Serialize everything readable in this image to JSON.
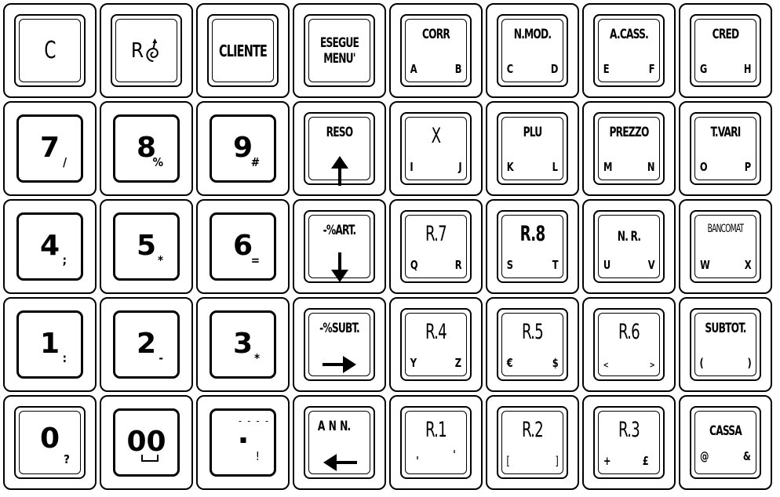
{
  "keyboard": {
    "rows": [
      [
        {
          "id": "c",
          "main": "C",
          "style": "double"
        },
        {
          "id": "r-spiral",
          "main": "R",
          "icon": "spiral-arrow-icon",
          "style": "double"
        },
        {
          "id": "cliente",
          "main": "CLIENTE",
          "style": "double"
        },
        {
          "id": "esegue-menu",
          "line1": "ESEGUE",
          "line2": "MENU'",
          "style": "double"
        },
        {
          "id": "corr",
          "top": "CORR",
          "left": "A",
          "right": "B",
          "style": "double"
        },
        {
          "id": "nmod",
          "top": "N.MOD.",
          "left": "C",
          "right": "D",
          "style": "double"
        },
        {
          "id": "acass",
          "top": "A.CASS.",
          "left": "E",
          "right": "F",
          "style": "double"
        },
        {
          "id": "cred",
          "top": "CRED",
          "left": "G",
          "right": "H",
          "style": "double"
        }
      ],
      [
        {
          "id": "7",
          "digit": "7",
          "sub": "/",
          "style": "single"
        },
        {
          "id": "8",
          "digit": "8",
          "sub": "%",
          "style": "single"
        },
        {
          "id": "9",
          "digit": "9",
          "sub": "#",
          "style": "single"
        },
        {
          "id": "reso",
          "top": "RESO",
          "icon": "arrow-up-icon",
          "style": "double"
        },
        {
          "id": "x",
          "main": "X",
          "left": "I",
          "right": "J",
          "style": "double"
        },
        {
          "id": "plu",
          "top": "PLU",
          "left": "K",
          "right": "L",
          "style": "double"
        },
        {
          "id": "prezzo",
          "top": "PREZZO",
          "left": "M",
          "right": "N",
          "style": "double"
        },
        {
          "id": "tvari",
          "top": "T.VARI",
          "left": "O",
          "right": "P",
          "style": "double"
        }
      ],
      [
        {
          "id": "4",
          "digit": "4",
          "sub": ";",
          "style": "single"
        },
        {
          "id": "5",
          "digit": "5",
          "sub": "*",
          "style": "single"
        },
        {
          "id": "6",
          "digit": "6",
          "sub": "=",
          "style": "single"
        },
        {
          "id": "pct-art",
          "top": "-%ART.",
          "icon": "arrow-down-icon",
          "style": "double"
        },
        {
          "id": "r7",
          "top": "R.7",
          "left": "Q",
          "right": "R",
          "style": "double"
        },
        {
          "id": "r8",
          "top": "R.8",
          "left": "S",
          "right": "T",
          "style": "double"
        },
        {
          "id": "nr",
          "top": "N. R.",
          "left": "U",
          "right": "V",
          "style": "double"
        },
        {
          "id": "bancomat",
          "top": "BANCOMAT",
          "left": "W",
          "right": "X",
          "style": "double"
        }
      ],
      [
        {
          "id": "1",
          "digit": "1",
          "sub": ":",
          "style": "single"
        },
        {
          "id": "2",
          "digit": "2",
          "sub": "-",
          "style": "single"
        },
        {
          "id": "3",
          "digit": "3",
          "sub": "*",
          "style": "single"
        },
        {
          "id": "pct-subt",
          "top": "-%SUBT.",
          "icon": "arrow-right-icon",
          "style": "double"
        },
        {
          "id": "r4",
          "top": "R.4",
          "left": "Y",
          "right": "Z",
          "style": "double"
        },
        {
          "id": "r5",
          "top": "R.5",
          "left": "€",
          "right": "$",
          "style": "double"
        },
        {
          "id": "r6",
          "top": "R.6",
          "left": "<",
          "right": ">",
          "style": "double"
        },
        {
          "id": "subtot",
          "top": "SUBTOT.",
          "left": "(",
          "right": ")",
          "style": "double"
        }
      ],
      [
        {
          "id": "0",
          "digit": "0",
          "sub": "?",
          "style": "double"
        },
        {
          "id": "00",
          "digit": "00",
          "sub": "space",
          "style": "single"
        },
        {
          "id": "dot",
          "digit": "·",
          "sub": "!",
          "overbar": "- - - -",
          "style": "single"
        },
        {
          "id": "ann",
          "top": "A N N.",
          "icon": "arrow-left-icon",
          "style": "double"
        },
        {
          "id": "r1",
          "top": "R.1",
          "left": "'",
          "right": "'",
          "style": "double"
        },
        {
          "id": "r2",
          "top": "R.2",
          "left": "[",
          "right": "]",
          "style": "double"
        },
        {
          "id": "r3",
          "top": "R.3",
          "left": "+",
          "right": "£",
          "style": "double"
        },
        {
          "id": "cassa",
          "top": "CASSA",
          "left": "@",
          "right": "&",
          "style": "double"
        }
      ]
    ]
  }
}
